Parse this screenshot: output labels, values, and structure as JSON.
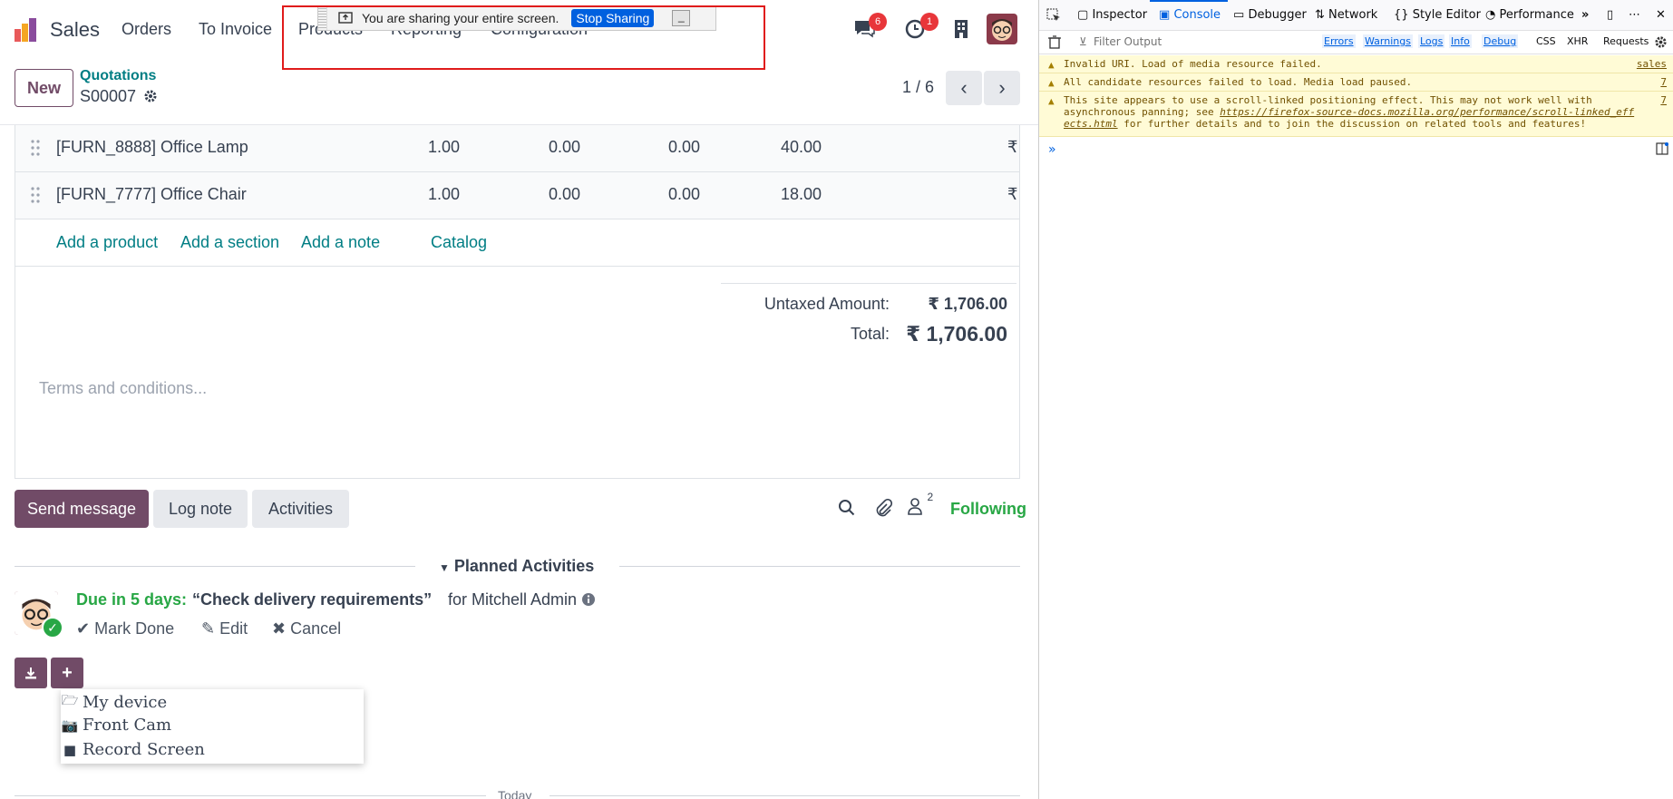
{
  "app": {
    "name": "Sales",
    "nav": [
      "Orders",
      "To Invoice",
      "Products",
      "Reporting",
      "Configuration"
    ],
    "messages_count": "6",
    "activities_count": "1"
  },
  "share_bar": {
    "text": "You are sharing your entire screen.",
    "stop": "Stop Sharing",
    "min": "_"
  },
  "control": {
    "new": "New",
    "breadcrumb": "Quotations",
    "record": "S00007",
    "pager": "1 / 6"
  },
  "lines": [
    {
      "product": "[FURN_8888] Office Lamp",
      "qty": "1.00",
      "c1": "0.00",
      "c2": "0.00",
      "price": "40.00",
      "cur": "₹"
    },
    {
      "product": "[FURN_7777] Office Chair",
      "qty": "1.00",
      "c1": "0.00",
      "c2": "0.00",
      "price": "18.00",
      "cur": "₹"
    }
  ],
  "add_links": {
    "product": "Add a product",
    "section": "Add a section",
    "note": "Add a note",
    "catalog": "Catalog"
  },
  "totals": {
    "untaxed_label": "Untaxed Amount:",
    "untaxed": "₹ 1,706.00",
    "total_label": "Total:",
    "total": "₹ 1,706.00"
  },
  "terms_placeholder": "Terms and conditions...",
  "chatter": {
    "send": "Send message",
    "log": "Log note",
    "activities": "Activities",
    "followers": "2",
    "following": "Following",
    "planned": "Planned Activities"
  },
  "activity": {
    "due": "Due in 5 days:",
    "title": "“Check delivery requirements”",
    "for": "for Mitchell Admin",
    "mark_done": "Mark Done",
    "edit": "Edit",
    "cancel": "Cancel"
  },
  "dropdown": [
    "My device",
    "Front Cam",
    "Record Screen"
  ],
  "today": "Today",
  "devtools": {
    "tabs": [
      "Inspector",
      "Console",
      "Debugger",
      "Network",
      "Style Editor",
      "Performance"
    ],
    "filter_placeholder": "Filter Output",
    "levels": [
      "Errors",
      "Warnings",
      "Logs",
      "Info",
      "Debug"
    ],
    "types": [
      "CSS",
      "XHR",
      "Requests"
    ],
    "messages": [
      {
        "text": "Invalid URI. Load of media resource  failed.",
        "src": "sales"
      },
      {
        "text": "All candidate resources failed to load. Media load paused.",
        "src": "7"
      },
      {
        "text": "This site appears to use a scroll-linked positioning effect. This may not work well with asynchronous panning; see",
        "link": "https://firefox-source-docs.mozilla.org/performance/scroll-linked_effects.html",
        "text2": " for further details and to join the discussion on related tools and features!",
        "src": "7"
      }
    ],
    "prompt": "»"
  },
  "colors": {
    "brand": "#714b67",
    "accent": "#017e84",
    "success": "#28a745"
  }
}
